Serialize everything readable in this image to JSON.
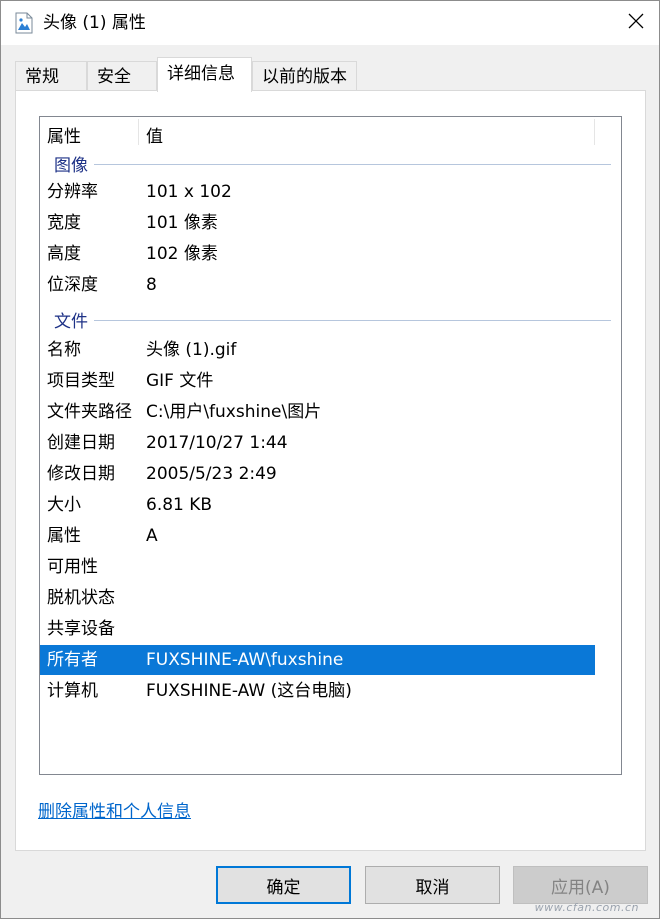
{
  "window": {
    "title": "头像 (1) 属性",
    "icons": {
      "title_icon": "image-file-icon",
      "close_icon": "close-icon"
    }
  },
  "tabs": [
    {
      "label": "常规"
    },
    {
      "label": "安全"
    },
    {
      "label": "详细信息",
      "active": true
    },
    {
      "label": "以前的版本"
    }
  ],
  "list": {
    "header": {
      "property": "属性",
      "value": "值"
    },
    "groups": [
      {
        "label": "图像",
        "rows": [
          {
            "key": "分辨率",
            "value": "101 x 102"
          },
          {
            "key": "宽度",
            "value": "101 像素"
          },
          {
            "key": "高度",
            "value": "102 像素"
          },
          {
            "key": "位深度",
            "value": "8"
          }
        ]
      },
      {
        "label": "文件",
        "rows": [
          {
            "key": "名称",
            "value": "头像 (1).gif"
          },
          {
            "key": "项目类型",
            "value": "GIF 文件"
          },
          {
            "key": "文件夹路径",
            "value": "C:\\用户\\fuxshine\\图片"
          },
          {
            "key": "创建日期",
            "value": "2017/10/27 1:44"
          },
          {
            "key": "修改日期",
            "value": "2005/5/23 2:49"
          },
          {
            "key": "大小",
            "value": "6.81 KB"
          },
          {
            "key": "属性",
            "value": "A"
          },
          {
            "key": "可用性",
            "value": ""
          },
          {
            "key": "脱机状态",
            "value": ""
          },
          {
            "key": "共享设备",
            "value": ""
          },
          {
            "key": "所有者",
            "value": "FUXSHINE-AW\\fuxshine",
            "selected": true
          },
          {
            "key": "计算机",
            "value": "FUXSHINE-AW (这台电脑)"
          }
        ]
      }
    ]
  },
  "remove_link": "删除属性和个人信息",
  "buttons": {
    "ok": "确定",
    "cancel": "取消",
    "apply": "应用(A)"
  },
  "watermark": "www.cfan.com.cn",
  "colors": {
    "selection": "#0a78d7",
    "link": "#0066cc",
    "group": "#1e3287"
  }
}
